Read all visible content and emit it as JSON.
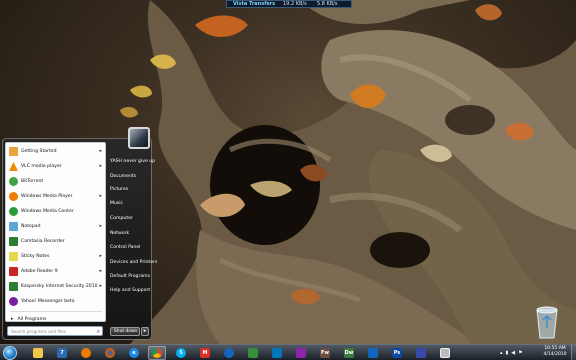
{
  "netmeter": {
    "title": "Vista Transfers",
    "download": "19.2 KB/s",
    "upload": "5.8 KB/s"
  },
  "start_menu": {
    "programs": [
      {
        "label": "Getting Started",
        "icon": "getting-started-icon",
        "color": "#e9a43c",
        "has_submenu": true
      },
      {
        "label": "VLC media player",
        "icon": "vlc-icon",
        "color": "#f08a00",
        "has_submenu": true
      },
      {
        "label": "BitTorrent",
        "icon": "bittorrent-icon",
        "color": "#43a047",
        "has_submenu": false
      },
      {
        "label": "Windows Media Player",
        "icon": "media-player-icon",
        "color": "#ef7b00",
        "has_submenu": true
      },
      {
        "label": "Windows Media Center",
        "icon": "media-center-icon",
        "color": "#2e9b3b",
        "has_submenu": false
      },
      {
        "label": "Notepad",
        "icon": "notepad-icon",
        "color": "#5da6d8",
        "has_submenu": true
      },
      {
        "label": "Camtasia Recorder",
        "icon": "camtasia-icon",
        "color": "#2e7d32",
        "has_submenu": false
      },
      {
        "label": "Sticky Notes",
        "icon": "sticky-notes-icon",
        "color": "#e6d84a",
        "has_submenu": true
      },
      {
        "label": "Adobe Reader 9",
        "icon": "adobe-reader-icon",
        "color": "#c62828",
        "has_submenu": true
      },
      {
        "label": "Kaspersky Internet Security 2010",
        "icon": "kaspersky-icon",
        "color": "#2e7d32",
        "has_submenu": true
      },
      {
        "label": "Yahoo! Messenger beta",
        "icon": "yahoo-messenger-icon",
        "color": "#7b1fa2",
        "has_submenu": false
      }
    ],
    "all_programs": "All Programs",
    "search_placeholder": "Search programs and files",
    "right_items": [
      "YASH never give up",
      "Documents",
      "Pictures",
      "Music",
      "Computer",
      "Network",
      "Control Panel",
      "Devices and Printers",
      "Default Programs",
      "Help and Support"
    ],
    "shutdown_label": "Shut down"
  },
  "taskbar": {
    "apps": [
      {
        "name": "explorer",
        "icon": "folder-icon",
        "color": "#f2c84b",
        "glyph": ""
      },
      {
        "name": "windows-7",
        "icon": "windows-7-icon",
        "color": "#2b6cb0",
        "glyph": "7"
      },
      {
        "name": "media-player",
        "icon": "media-player-icon",
        "color": "#ef7b00",
        "glyph": ""
      },
      {
        "name": "firefox",
        "icon": "firefox-icon",
        "color": "#e66000",
        "glyph": ""
      },
      {
        "name": "ie",
        "icon": "internet-explorer-icon",
        "color": "#1e88e5",
        "glyph": "e"
      },
      {
        "name": "chrome",
        "icon": "chrome-icon",
        "color": "#4caf50",
        "glyph": ""
      },
      {
        "name": "skype",
        "icon": "skype-icon",
        "color": "#00aff0",
        "glyph": "S"
      },
      {
        "name": "gmail",
        "icon": "gmail-icon",
        "color": "#d93025",
        "glyph": "M"
      },
      {
        "name": "azureus",
        "icon": "azureus-frog-icon",
        "color": "#1565c0",
        "glyph": ""
      },
      {
        "name": "app-green",
        "icon": "app-icon",
        "color": "#388e3c",
        "glyph": ""
      },
      {
        "name": "app-tile",
        "icon": "app-icon",
        "color": "#0277bd",
        "glyph": ""
      },
      {
        "name": "app-paint",
        "icon": "paint-icon",
        "color": "#8e24aa",
        "glyph": ""
      },
      {
        "name": "fireworks",
        "icon": "fireworks-icon",
        "color": "#6d4c41",
        "glyph": "Fw"
      },
      {
        "name": "dreamweaver",
        "icon": "dreamweaver-icon",
        "color": "#3b7d3b",
        "glyph": "Dw"
      },
      {
        "name": "flash",
        "icon": "flash-icon",
        "color": "#1565c0",
        "glyph": ""
      },
      {
        "name": "photoshop",
        "icon": "photoshop-icon",
        "color": "#0d47a1",
        "glyph": "Ps"
      },
      {
        "name": "snipping",
        "icon": "app-icon",
        "color": "#3949ab",
        "glyph": ""
      },
      {
        "name": "window",
        "icon": "window-icon",
        "color": "#bdbdbd",
        "glyph": ""
      }
    ],
    "clock_time": "10:55 AM",
    "clock_date": "4/14/2010"
  }
}
